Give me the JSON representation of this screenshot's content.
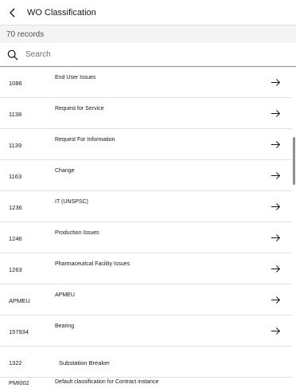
{
  "header": {
    "title": "WO Classification"
  },
  "records": {
    "label": "70 records"
  },
  "search": {
    "placeholder": "Search"
  },
  "rows": [
    {
      "code": "1086",
      "description": "End User Issues"
    },
    {
      "code": "1138",
      "description": "Request for Service"
    },
    {
      "code": "1139",
      "description": "Request For Information"
    },
    {
      "code": "1163",
      "description": "Change"
    },
    {
      "code": "1236",
      "description": "IT (UNSPSC)"
    },
    {
      "code": "1246",
      "description": "Production Issues"
    },
    {
      "code": "1263",
      "description": "Pharmaceutical Facility Issues"
    },
    {
      "code": "APMEU",
      "description": "APMEU"
    },
    {
      "code": "157934",
      "description": "Bearing"
    },
    {
      "code": "1322",
      "description": "Substation Breaker"
    },
    {
      "code": "PMI002",
      "description": "Default classification for Contract instance"
    }
  ],
  "icons": {
    "back": "chevron-left-icon",
    "search": "search-icon",
    "row_arrow": "arrow-right-icon"
  },
  "colors": {
    "count_bar_bg": "#f4f4f4",
    "text": "#161616",
    "divider": "#e0e0e0"
  }
}
